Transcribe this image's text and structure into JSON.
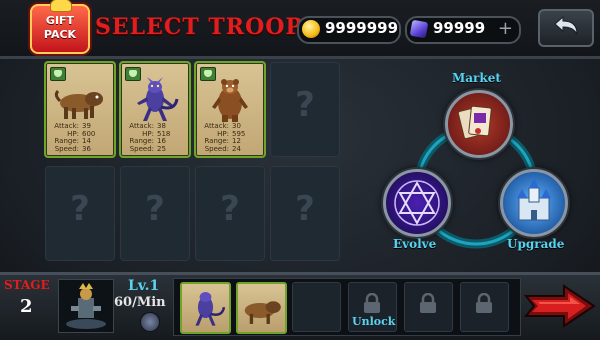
{
  "header": {
    "gift_line1": "GIFT",
    "gift_line2": "PACK",
    "title": "SELECT TROOPS",
    "coins": "9999999",
    "gems": "99999",
    "plus_label": "+"
  },
  "troops": [
    {
      "name": "hound",
      "icon": "dog-creature-icon",
      "attack_label": "Attack:",
      "attack": "39",
      "hp_label": "HP:",
      "hp": "600",
      "range_label": "Range:",
      "range": "14",
      "speed_label": "Speed:",
      "speed": "36"
    },
    {
      "name": "wolf",
      "icon": "wolf-creature-icon",
      "attack_label": "Attack:",
      "attack": "38",
      "hp_label": "HP:",
      "hp": "518",
      "range_label": "Range:",
      "range": "16",
      "speed_label": "Speed:",
      "speed": "25"
    },
    {
      "name": "bear",
      "icon": "bear-creature-icon",
      "attack_label": "Attack:",
      "attack": "30",
      "hp_label": "HP:",
      "hp": "595",
      "range_label": "Range:",
      "range": "12",
      "speed_label": "Speed:",
      "speed": "24"
    }
  ],
  "empty_slot_symbol": "?",
  "menu": {
    "market": "Market",
    "evolve": "Evolve",
    "upgrade": "Upgrade"
  },
  "footer": {
    "stage_label": "STAGE",
    "stage_number": "2",
    "level": "Lv.1",
    "rate": "60/Min",
    "unlock_label": "Unlock"
  },
  "colors": {
    "accent_red": "#e31d1d",
    "accent_cyan": "#5ad2ee",
    "frame_green": "#6fa32a"
  }
}
